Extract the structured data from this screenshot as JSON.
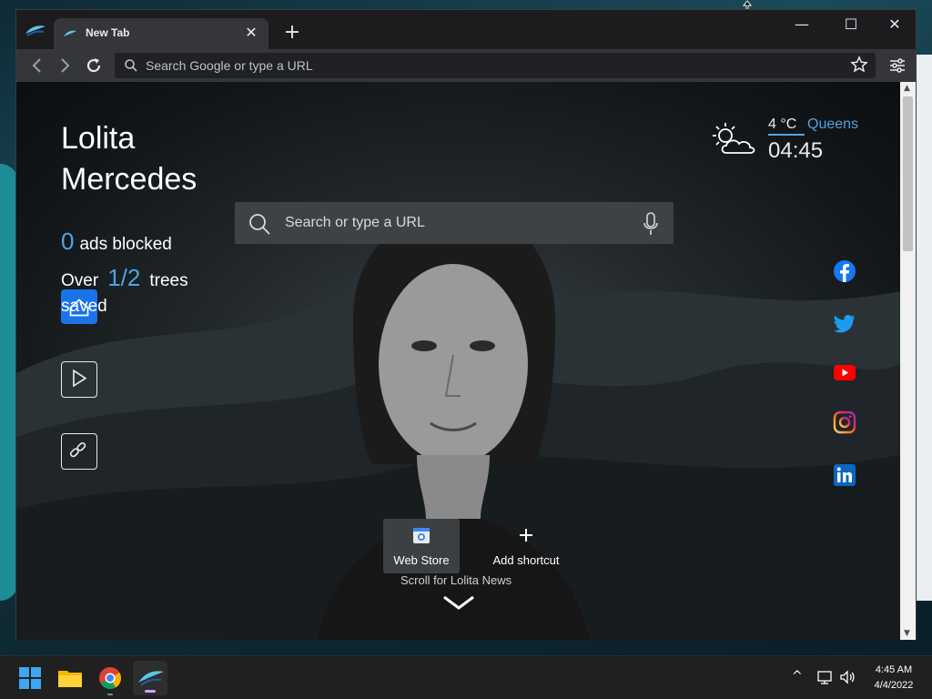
{
  "browser": {
    "tab_title": "New Tab",
    "new_tab_symbol": "+",
    "close_symbol": "✕",
    "omnibox_placeholder": "Search Google or type a URL",
    "window_controls": {
      "minimize": "—",
      "maximize": "☐",
      "close": "✕"
    }
  },
  "page": {
    "user_name_first": "Lolita",
    "user_name_last": "Mercedes",
    "ads_blocked_count": "0",
    "ads_blocked_label": "ads blocked",
    "trees_prefix": "Over",
    "trees_count": "1/2",
    "trees_label": "trees",
    "trees_suffix": "saved",
    "search_placeholder": "Search or type a URL",
    "weather": {
      "temperature": "4 °C",
      "city": "Queens",
      "time": "04:45",
      "icon": "partly-cloudy-icon"
    },
    "shortcuts": [
      {
        "label": "Web Store",
        "icon": "webstore-icon"
      },
      {
        "label": "Add shortcut",
        "icon": "plus-icon"
      }
    ],
    "news_label": "Scroll for Lolita News",
    "social_links": [
      "facebook-icon",
      "twitter-icon",
      "youtube-icon",
      "instagram-icon",
      "linkedin-icon"
    ]
  },
  "taskbar": {
    "time": "4:45 AM",
    "date": "4/4/2022",
    "tray_chevron": "^"
  },
  "colors": {
    "accent_blue": "#4fa3e6",
    "home_button": "#1a73e8",
    "youtube_red": "#ff0000",
    "facebook_blue": "#1877f2",
    "twitter_blue": "#1d9bf0",
    "linkedin_blue": "#0a66c2"
  }
}
